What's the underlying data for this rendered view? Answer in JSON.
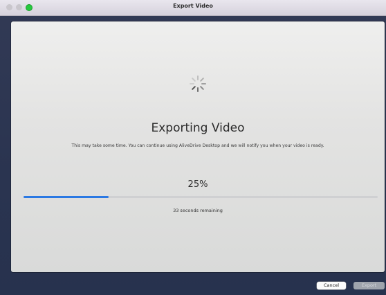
{
  "window": {
    "title": "Export Video"
  },
  "export": {
    "heading": "Exporting Video",
    "description": "This may take some time. You can continue using AliveDrive Desktop and we will notify you when your video is ready.",
    "percent_label": "25%",
    "progress": 0.24,
    "remaining": "33 seconds remaining"
  },
  "buttons": {
    "cancel": "Cancel",
    "export": "Export"
  },
  "colors": {
    "progress_fill": "#2b79e3",
    "progress_track": "#cfd0d2"
  },
  "icons": {
    "spinner": "loading-spinner-icon"
  }
}
